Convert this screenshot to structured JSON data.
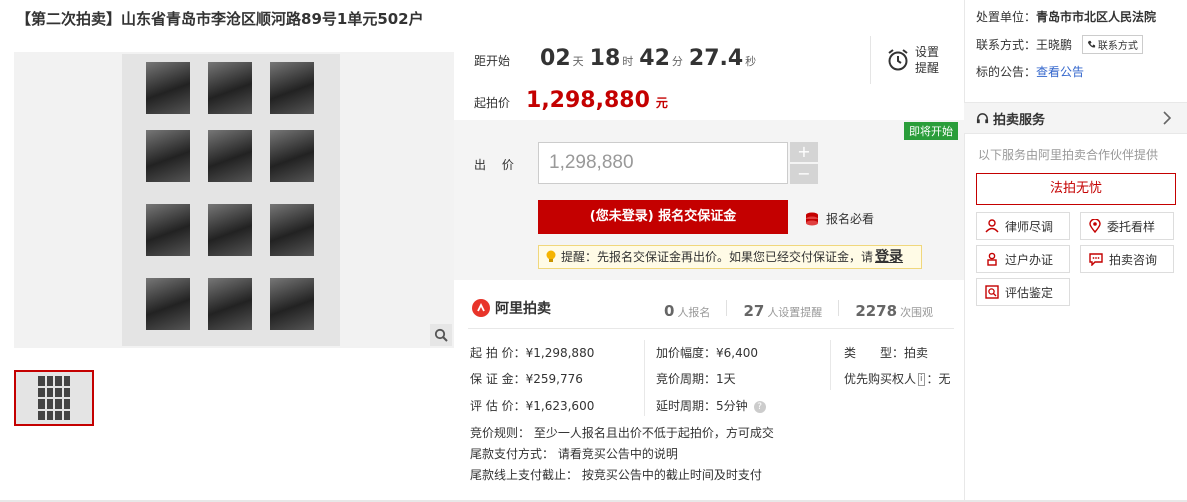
{
  "title": "【第二次拍卖】山东省青岛市李沧区顺河路89号1单元502户",
  "countdown": {
    "label": "距开始",
    "days": "02",
    "days_unit": "天",
    "hours": "18",
    "hours_unit": "时",
    "minutes": "42",
    "minutes_unit": "分",
    "seconds": "27.4",
    "seconds_unit": "秒"
  },
  "remind": {
    "label": "设置提醒",
    "icon": "alarm-clock-icon"
  },
  "start_price": {
    "label": "起拍价",
    "value": "1,298,880",
    "unit": "元"
  },
  "bid": {
    "badge": "即将开始",
    "label": "出 价",
    "input_value": "1,298,880",
    "plus": "+",
    "minus": "−",
    "signup_label": "(您未登录) 报名交保证金",
    "must_read": "报名必看",
    "tip_text": "提醒：先报名交保证金再出价。如果您已经交付保证金，请",
    "tip_login": "登录"
  },
  "brand": {
    "name": "阿里拍卖"
  },
  "stats": {
    "signup_count": "0",
    "signup_label": "人报名",
    "remind_count": "27",
    "remind_label": "人设置提醒",
    "view_count": "2278",
    "view_label": "次围观"
  },
  "details": {
    "start_price": "起 拍 价：¥1,298,880",
    "deposit": "保 证 金：¥259,776",
    "appraisal": "评 估 价：¥1,623,600",
    "increment": "加价幅度：¥6,400",
    "cycle": "竞价周期：1天",
    "delay": "延时周期：5分钟",
    "type_label": "类　　型：",
    "type_value": "拍卖",
    "priority_prefix": "优先购买权人",
    "priority_tag": "i",
    "priority_suffix": "：无"
  },
  "rules": {
    "bidding": "竞价规则：  至少一人报名且出价不低于起拍价，方可成交",
    "payment": "尾款支付方式：  请看竞买公告中的说明",
    "deadline": "尾款线上支付截止：  按竞买公告中的截止时间及时支付"
  },
  "sidebar": {
    "court_label": "处置单位：",
    "court_value": "青岛市市北区人民法院",
    "contact_label": "联系方式：",
    "contact_name": "王晓鹏",
    "contact_button": "联系方式",
    "notice_label": "标的公告：",
    "notice_link": "查看公告",
    "service_title": "拍卖服务",
    "service_desc": "以下服务由阿里拍卖合作伙伴提供",
    "fapai_button": "法拍无忧",
    "services": [
      "律师尽调",
      "委托看样",
      "过户办证",
      "拍卖咨询",
      "评估鉴定"
    ]
  },
  "colors": {
    "accent": "#c40000",
    "badge_green": "#2a9d3a",
    "link": "#3366cc"
  }
}
